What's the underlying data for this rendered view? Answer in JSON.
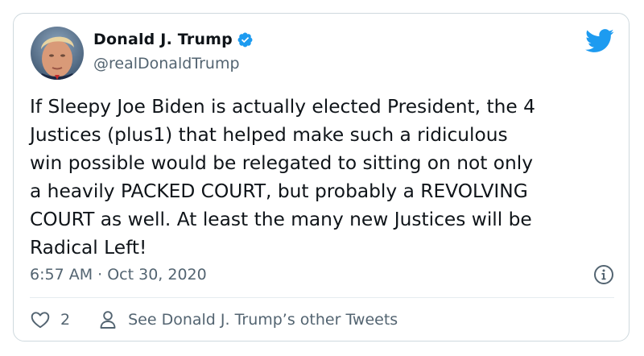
{
  "author": {
    "display_name": "Donald J. Trump",
    "handle": "@realDonaldTrump",
    "verified": true
  },
  "tweet": {
    "text": "If Sleepy Joe Biden is actually elected President, the 4\nJustices (plus1) that helped make such a ridiculous\nwin possible would be relegated to sitting on not only\na heavily PACKED COURT, but probably a REVOLVING\nCOURT as well. At least the many new Justices will be\nRadical Left!",
    "timestamp": "6:57 AM · Oct 30, 2020"
  },
  "actions": {
    "like_count": "2",
    "profile_link": "See Donald J. Trump’s other Tweets"
  },
  "icons": {
    "brand": "twitter-bird-icon",
    "verified": "verified-badge-icon",
    "info": "info-icon",
    "like": "heart-icon",
    "profile": "person-icon"
  },
  "colors": {
    "brand_blue": "#1d9bf0",
    "text_primary": "#0f1419",
    "text_secondary": "#536471",
    "border": "#cfd9de"
  }
}
